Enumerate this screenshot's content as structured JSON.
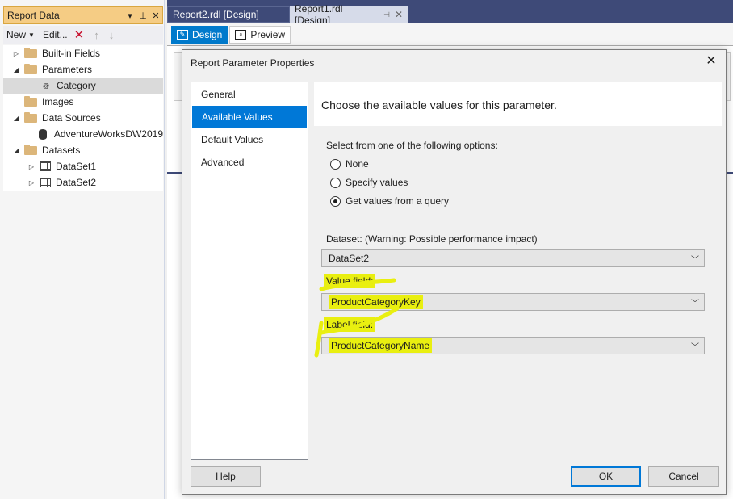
{
  "report_data_panel": {
    "title": "Report Data",
    "toolbar": {
      "new_label": "New",
      "edit_label": "Edit..."
    },
    "tree": [
      {
        "label": "Built-in Fields",
        "level": 0,
        "expander": "closed",
        "icon": "folder-icon"
      },
      {
        "label": "Parameters",
        "level": 0,
        "expander": "open",
        "icon": "folder-icon"
      },
      {
        "label": "Category",
        "level": 1,
        "expander": "none",
        "icon": "parameter-icon",
        "selected": true
      },
      {
        "label": "Images",
        "level": 0,
        "expander": "none",
        "icon": "folder-icon"
      },
      {
        "label": "Data Sources",
        "level": 0,
        "expander": "open",
        "icon": "folder-icon"
      },
      {
        "label": "AdventureWorksDW2019",
        "level": 1,
        "expander": "none",
        "icon": "database-icon"
      },
      {
        "label": "Datasets",
        "level": 0,
        "expander": "open",
        "icon": "folder-icon"
      },
      {
        "label": "DataSet1",
        "level": 1,
        "expander": "closed",
        "icon": "table-icon"
      },
      {
        "label": "DataSet2",
        "level": 1,
        "expander": "closed",
        "icon": "table-icon"
      }
    ]
  },
  "doc_tabs": [
    {
      "label": "Report2.rdl [Design]"
    },
    {
      "label": "Report1.rdl [Design]"
    }
  ],
  "designer_tabs": {
    "design": "Design",
    "preview": "Preview"
  },
  "dialog": {
    "title": "Report Parameter Properties",
    "nav": [
      "General",
      "Available Values",
      "Default Values",
      "Advanced"
    ],
    "active_nav": "Available Values",
    "header": "Choose the available values for this parameter.",
    "options_label": "Select from one of the following options:",
    "options": [
      {
        "label": "None",
        "checked": false
      },
      {
        "label": "Specify values",
        "checked": false
      },
      {
        "label": "Get values from a query",
        "checked": true
      }
    ],
    "dataset_label": "Dataset: (Warning: Possible performance impact)",
    "dataset_value": "DataSet2",
    "value_field_label": "Value field:",
    "value_field_value": "ProductCategoryKey",
    "label_field_label": "Label field:",
    "label_field_value": "ProductCategoryName",
    "buttons": {
      "help": "Help",
      "ok": "OK",
      "cancel": "Cancel"
    }
  },
  "colors": {
    "highlight": "#e9ef10",
    "accent": "#0078d7",
    "panel_title": "#f5cc84",
    "vs_dark": "#3e4a78"
  }
}
